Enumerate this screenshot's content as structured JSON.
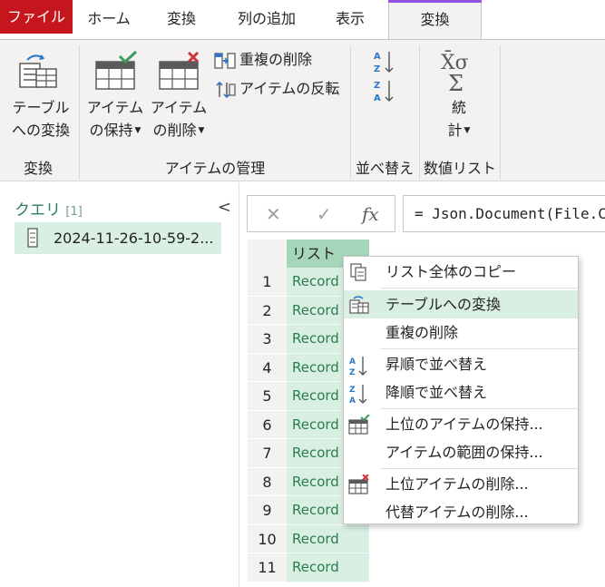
{
  "tabs": [
    "ファイル",
    "ホーム",
    "変換",
    "列の追加",
    "表示",
    "変換"
  ],
  "ribbon": {
    "to_table": [
      "テーブル",
      "への変換"
    ],
    "group_convert": "変換",
    "keep_items": [
      "アイテム",
      "の保持"
    ],
    "remove_items": [
      "アイテム",
      "の削除"
    ],
    "remove_duplicates": "重複の削除",
    "reverse_items": "アイテムの反転",
    "group_manage": "アイテムの管理",
    "group_sort": "並べ替え",
    "statistics": [
      "統",
      "計"
    ],
    "group_numeric": "数値リスト"
  },
  "queries": {
    "title": "クエリ",
    "count": "[1]",
    "collapse": "<",
    "items": [
      "2024-11-26-10-59-2..."
    ]
  },
  "formula": {
    "cancel": "✕",
    "commit": "✓",
    "fx": "fx",
    "text": "= Json.Document(File.C"
  },
  "grid": {
    "header": "リスト",
    "rows": [
      {
        "n": "1",
        "v": "Record"
      },
      {
        "n": "2",
        "v": "Record"
      },
      {
        "n": "3",
        "v": "Record"
      },
      {
        "n": "4",
        "v": "Record"
      },
      {
        "n": "5",
        "v": "Record"
      },
      {
        "n": "6",
        "v": "Record"
      },
      {
        "n": "7",
        "v": "Record"
      },
      {
        "n": "8",
        "v": "Record"
      },
      {
        "n": "9",
        "v": "Record"
      },
      {
        "n": "10",
        "v": "Record"
      },
      {
        "n": "11",
        "v": "Record"
      }
    ]
  },
  "menu": [
    "リスト全体のコピー",
    "テーブルへの変換",
    "重複の削除",
    "昇順で並べ替え",
    "降順で並べ替え",
    "上位のアイテムの保持...",
    "アイテムの範囲の保持...",
    "上位アイテムの削除...",
    "代替アイテムの削除..."
  ],
  "colors": {
    "file_tab": "#c4161c",
    "accent_green": "#2e7d5b",
    "selection_green": "#d8efe2",
    "header_green": "#a5d6b9",
    "tab_accent": "#9254de"
  }
}
